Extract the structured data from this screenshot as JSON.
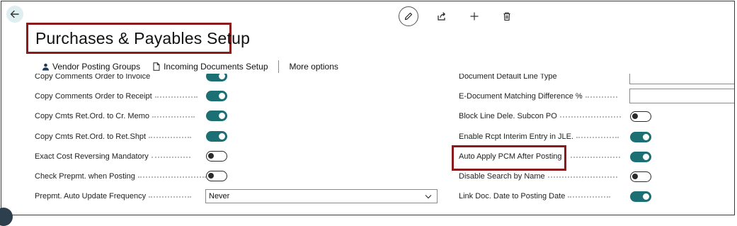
{
  "page": {
    "title": "Purchases & Payables Setup"
  },
  "icons": {
    "back": "arrow-left-icon",
    "edit": "pencil-icon",
    "share": "share-icon",
    "new": "plus-icon",
    "delete": "trash-icon",
    "vendor_posting": "person-icon",
    "incoming_docs": "document-icon",
    "dropdown": "chevron-down-icon"
  },
  "colors": {
    "accent": "#1c6f73",
    "highlight": "#8b1a1a"
  },
  "actionbar": {
    "vendor_posting_groups": "Vendor Posting Groups",
    "incoming_documents_setup": "Incoming Documents Setup",
    "more_options": "More options"
  },
  "left_fields": [
    {
      "label": "Copy Comments Order to Invoice",
      "type": "toggle",
      "value": true
    },
    {
      "label": "Copy Comments Order to Receipt",
      "type": "toggle",
      "value": true
    },
    {
      "label": "Copy Cmts Ret.Ord. to Cr. Memo",
      "type": "toggle",
      "value": true
    },
    {
      "label": "Copy Cmts Ret.Ord. to Ret.Shpt",
      "type": "toggle",
      "value": true
    },
    {
      "label": "Exact Cost Reversing Mandatory",
      "type": "toggle",
      "value": false
    },
    {
      "label": "Check Prepmt. when Posting",
      "type": "toggle",
      "value": false
    },
    {
      "label": "Prepmt. Auto Update Frequency",
      "type": "select",
      "value": "Never"
    }
  ],
  "right_fields": [
    {
      "label": "Document Default Line Type",
      "type": "input",
      "value": ""
    },
    {
      "label": "E-Document Matching Difference %",
      "type": "input",
      "value": ""
    },
    {
      "label": "Block Line Dele. Subcon PO",
      "type": "toggle",
      "value": false
    },
    {
      "label": "Enable Rcpt Interim Entry in JLE.",
      "type": "toggle",
      "value": true
    },
    {
      "label": "Auto Apply PCM After Posting",
      "type": "toggle",
      "value": true
    },
    {
      "label": "Disable Search by Name",
      "type": "toggle",
      "value": false
    },
    {
      "label": "Link Doc. Date to Posting Date",
      "type": "toggle",
      "value": true
    }
  ]
}
